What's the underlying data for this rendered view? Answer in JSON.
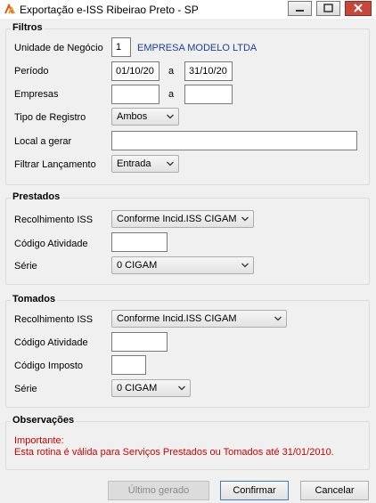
{
  "window": {
    "title": "Exportação e-ISS Ribeirao Preto - SP"
  },
  "filtros": {
    "legend": "Filtros",
    "unidade_label": "Unidade de Negócio",
    "unidade_value": "1",
    "unidade_name": "EMPRESA MODELO LTDA",
    "periodo_label": "Período",
    "periodo_from": "01/10/20",
    "periodo_sep": "a",
    "periodo_to": "31/10/20",
    "empresas_label": "Empresas",
    "empresas_from": "",
    "empresas_sep": "a",
    "empresas_to": "",
    "tipo_label": "Tipo de Registro",
    "tipo_value": "Ambos",
    "local_label": "Local a gerar",
    "local_value": "",
    "filtrar_label": "Filtrar Lançamento",
    "filtrar_value": "Entrada"
  },
  "prestados": {
    "legend": "Prestados",
    "recolhimento_label": "Recolhimento ISS",
    "recolhimento_value": "Conforme Incid.ISS CIGAM",
    "codigo_label": "Código Atividade",
    "codigo_value": "",
    "serie_label": "Série",
    "serie_value": "0 CIGAM"
  },
  "tomados": {
    "legend": "Tomados",
    "recolhimento_label": "Recolhimento ISS",
    "recolhimento_value": "Conforme Incid.ISS CIGAM",
    "codigo_label": "Código Atividade",
    "codigo_value": "",
    "imposto_label": "Código Imposto",
    "imposto_value": "",
    "serie_label": "Série",
    "serie_value": "0 CIGAM"
  },
  "observacoes": {
    "legend": "Observações",
    "line1": "Importante:",
    "line2": "Esta rotina é válida para Serviços Prestados ou Tomados até 31/01/2010."
  },
  "buttons": {
    "ultimo": "Último gerado",
    "confirmar": "Confirmar",
    "cancelar": "Cancelar"
  },
  "colors": {
    "warning_text": "#d00000",
    "link_blue": "#1a3f9c"
  }
}
